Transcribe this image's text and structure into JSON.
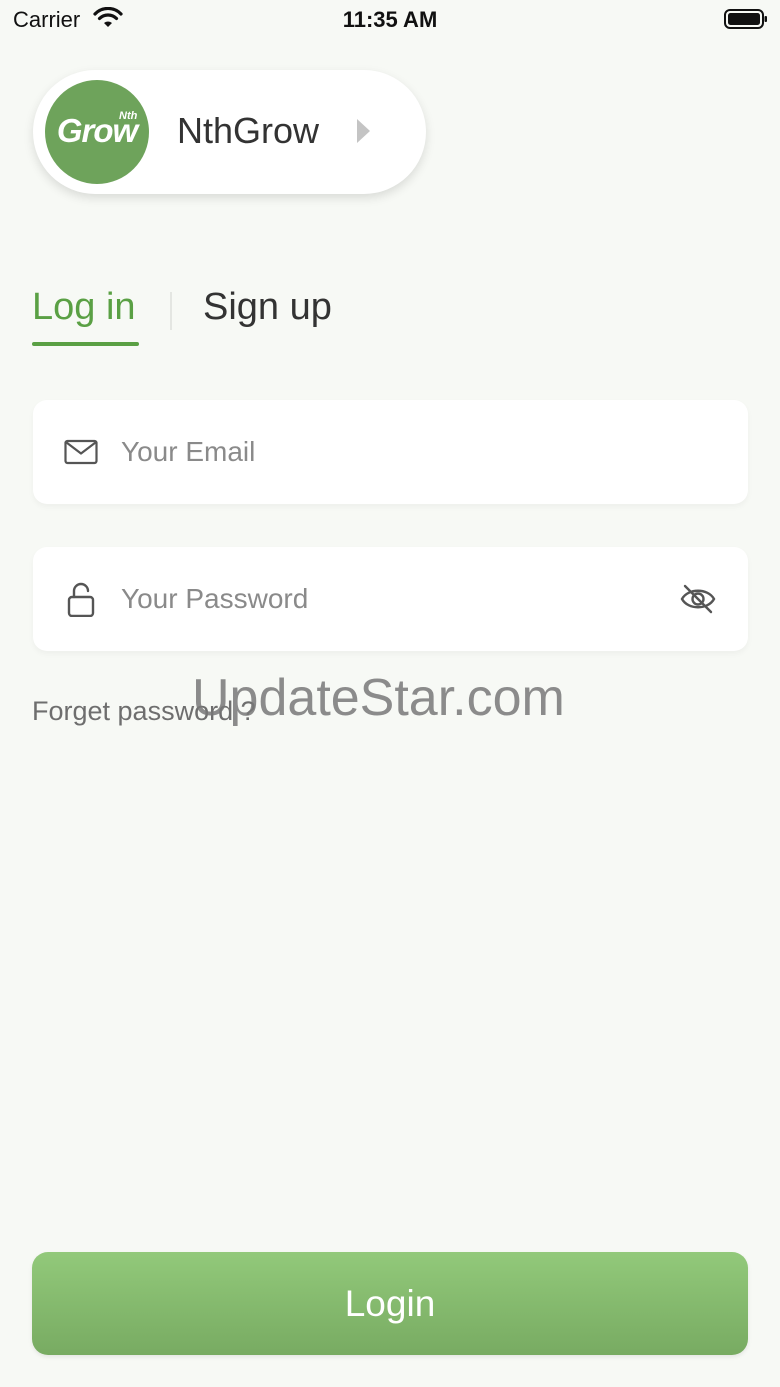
{
  "status_bar": {
    "carrier": "Carrier",
    "time": "11:35 AM"
  },
  "brand": {
    "logo_text": "Grow",
    "logo_sup": "Nth",
    "name": "NthGrow"
  },
  "tabs": {
    "login": "Log in",
    "signup": "Sign up",
    "active": "login"
  },
  "form": {
    "email_placeholder": "Your Email",
    "email_value": "",
    "password_placeholder": "Your Password",
    "password_value": "",
    "forget_link": "Forget password ?"
  },
  "watermark": "UpdateStar.com",
  "login_button": "Login",
  "colors": {
    "accent": "#5aa044",
    "logo_bg": "#6ea35b",
    "button_top": "#92c97a",
    "button_bottom": "#78ab62",
    "background": "#f7f9f5"
  },
  "icons": {
    "email": "envelope-icon",
    "password": "padlock-icon",
    "visibility": "eye-off-icon",
    "brand_chevron": "chevron-right-icon"
  }
}
